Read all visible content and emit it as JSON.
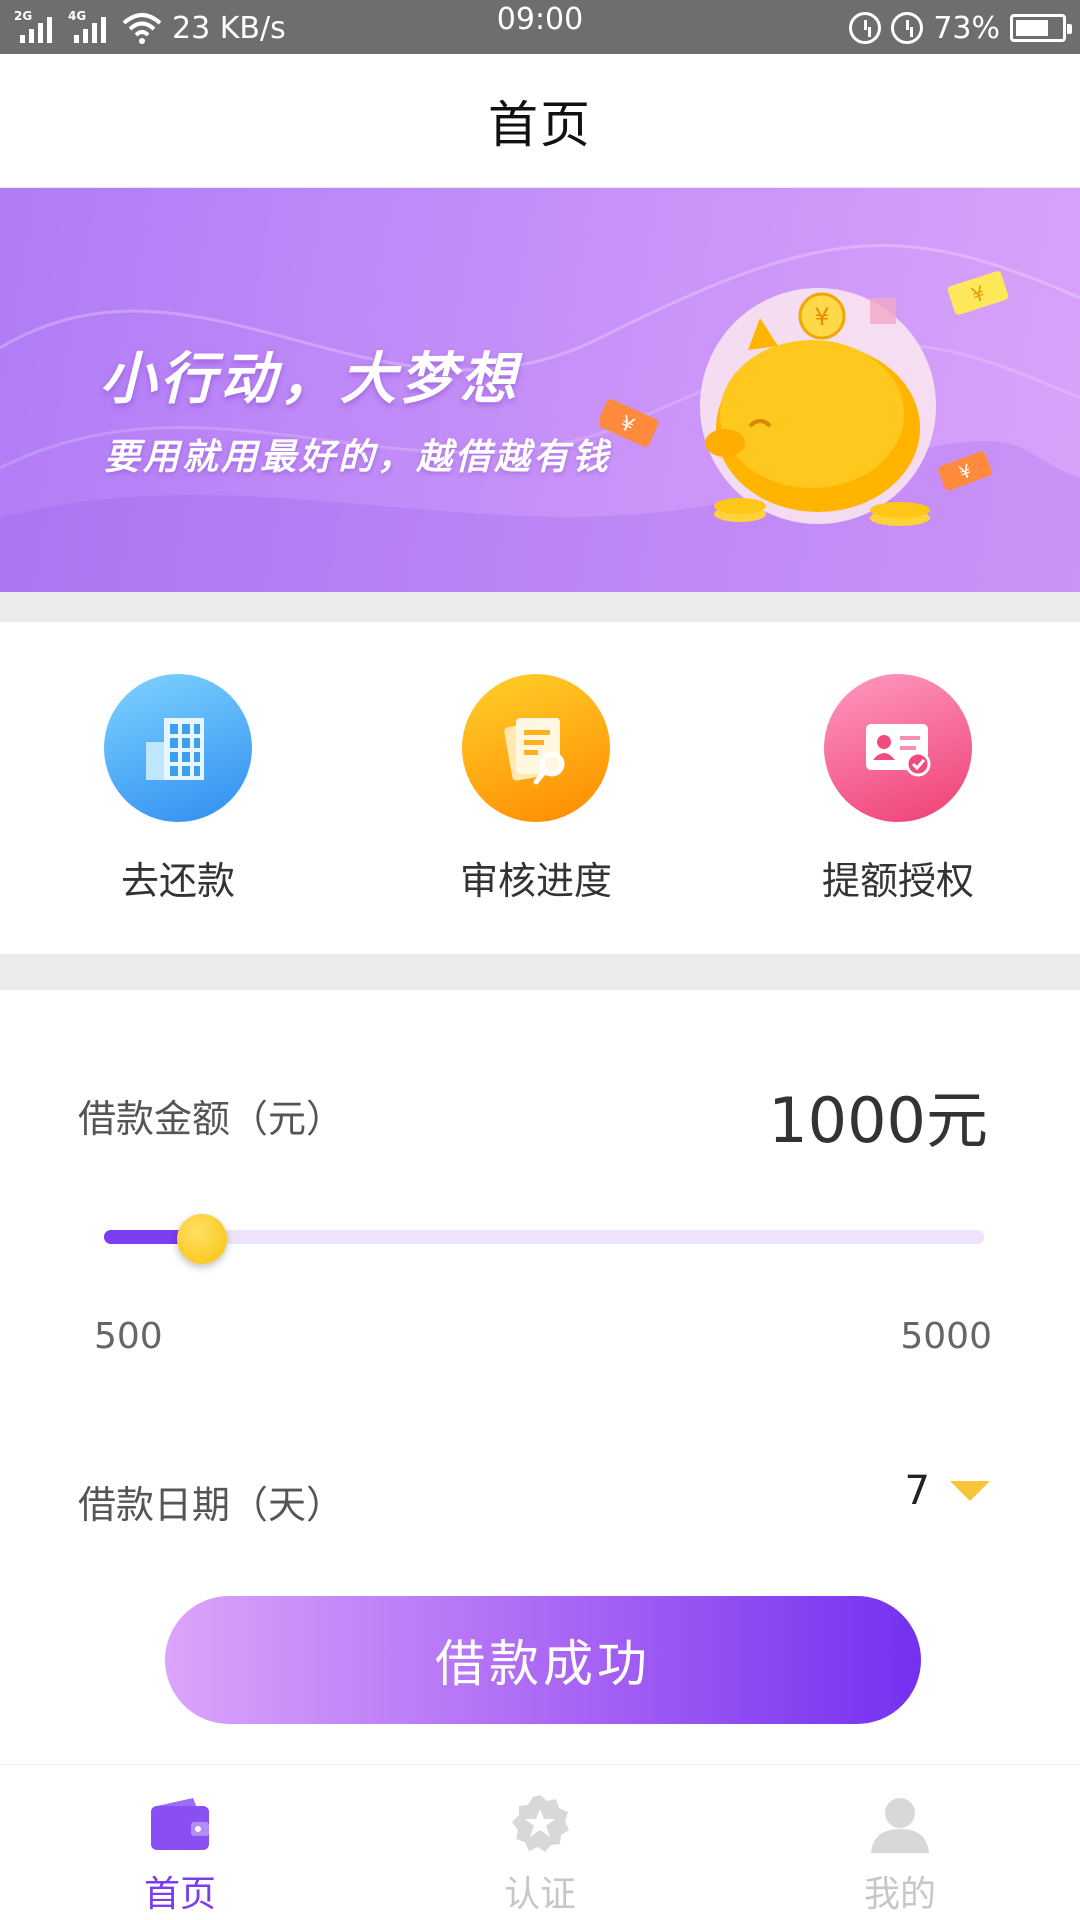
{
  "status_bar": {
    "net1": "2G",
    "net2": "4G",
    "speed": "23 KB/s",
    "time": "09:00",
    "battery": "73%"
  },
  "header": {
    "title": "首页"
  },
  "banner": {
    "headline": "小行动，大梦想",
    "subline": "要用就用最好的，越借越有钱"
  },
  "actions": [
    {
      "label": "去还款",
      "icon": "building-icon",
      "color": "#3fa9f5"
    },
    {
      "label": "审核进度",
      "icon": "document-search-icon",
      "color": "#ffa310"
    },
    {
      "label": "提额授权",
      "icon": "id-card-icon",
      "color": "#f24a7c"
    }
  ],
  "loan": {
    "amount_label": "借款金额（元）",
    "amount_value": "1000元",
    "slider_min": "500",
    "slider_max": "5000",
    "slider_value": 1000,
    "slider_min_num": 500,
    "slider_max_num": 5000,
    "days_label": "借款日期（天）",
    "days_value": "7",
    "submit_label": "借款成功"
  },
  "tabs": [
    {
      "label": "首页",
      "icon": "wallet-icon",
      "active": true
    },
    {
      "label": "认证",
      "icon": "badge-star-icon",
      "active": false
    },
    {
      "label": "我的",
      "icon": "user-icon",
      "active": false
    }
  ],
  "colors": {
    "accent": "#7b3cf0",
    "thumb": "#f7c20a",
    "banner": "#c48ef8"
  }
}
